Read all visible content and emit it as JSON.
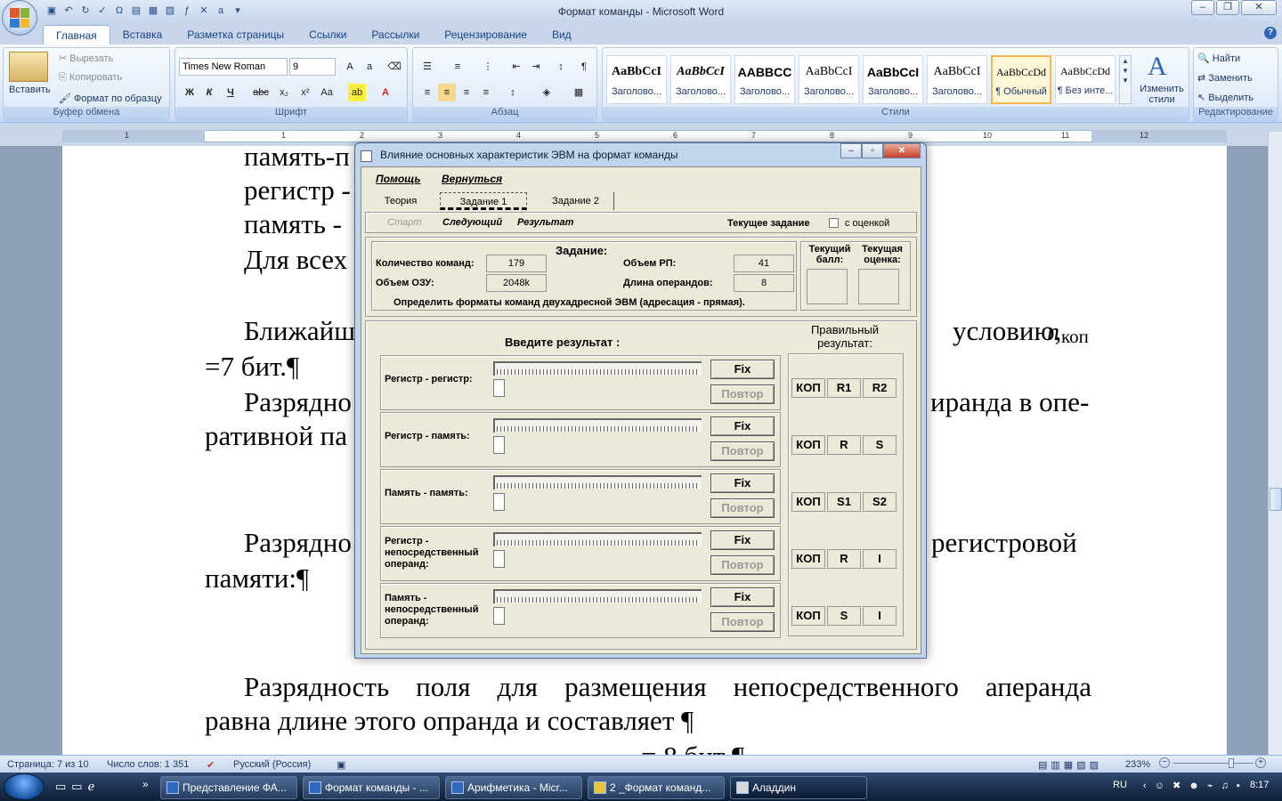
{
  "app": {
    "window_title": "Формат команды - Microsoft Word",
    "tabs": [
      "Главная",
      "Вставка",
      "Разметка страницы",
      "Ссылки",
      "Рассылки",
      "Рецензирование",
      "Вид"
    ],
    "active_tab": "Главная"
  },
  "ribbon": {
    "clipboard": {
      "label": "Буфер обмена",
      "paste": "Вставить",
      "cut": "Вырезать",
      "copy": "Копировать",
      "format_painter": "Формат по образцу"
    },
    "font": {
      "label": "Шрифт",
      "font_name": "Times New Roman",
      "font_size": "9"
    },
    "paragraph": {
      "label": "Абзац"
    },
    "styles": {
      "label": "Стили",
      "items": [
        {
          "sample": "AaBbCcI",
          "name": "Заголово..."
        },
        {
          "sample": "AaBbCcI",
          "name": "Заголово..."
        },
        {
          "sample": "AABBCC",
          "name": "Заголово..."
        },
        {
          "sample": "AaBbCcI",
          "name": "Заголово..."
        },
        {
          "sample": "AaBbCcI",
          "name": "Заголово..."
        },
        {
          "sample": "AaBbCcI",
          "name": "Заголово..."
        },
        {
          "sample": "AaBbCcDd",
          "name": "¶ Обычный"
        },
        {
          "sample": "AaBbCcDd",
          "name": "¶ Без инте..."
        }
      ],
      "change_styles": "Изменить стили"
    },
    "editing": {
      "label": "Редактирование",
      "find": "Найти",
      "replace": "Заменить",
      "select": "Выделить"
    }
  },
  "ruler": {
    "numbers": [
      "1",
      "1",
      "2",
      "3",
      "4",
      "5",
      "6",
      "7",
      "8",
      "9",
      "10",
      "11",
      "12"
    ]
  },
  "document": {
    "lines": [
      "память-п",
      "регистр -",
      "память -",
      "Для всех",
      "Ближайш",
      "условию,",
      "n",
      "коп",
      "=7 бит.¶",
      "Разрядно",
      "иранда в опе-",
      "ративной па",
      "Разрядно",
      "регистровой",
      "памяти:¶",
      "Разрядность поля для размещения непосредственного аперанда",
      "равна длине этого опранда и составляет ¶",
      "= 8 бит ¶"
    ]
  },
  "status": {
    "page": "Страница: 7 из 10",
    "words": "Число слов: 1 351",
    "language": "Русский (Россия)",
    "zoom": "233%"
  },
  "taskbar": {
    "tasks": [
      "Представление ФА...",
      "Формат команды - ...",
      "Арифметика - Micr...",
      "2 _Формат команд...",
      "Аладдин"
    ],
    "lang": "RU",
    "time": "8:17"
  },
  "dialog": {
    "title": "Влияние основных характеристик ЭВМ на формат команды",
    "menu": [
      "Помощь",
      "Вернуться"
    ],
    "tabs": [
      "Теория",
      "Задание 1",
      "Задание 2"
    ],
    "actions": {
      "start": "Старт",
      "next": "Следующий",
      "result": "Результат",
      "current_task": "Текущее задание",
      "with_grade": "с оценкой"
    },
    "task": {
      "heading": "Задание:",
      "cmd_count_label": "Количество команд:",
      "cmd_count": "179",
      "ram_label": "Объем ОЗУ:",
      "ram": "2048k",
      "rp_label": "Объем РП:",
      "rp": "41",
      "operand_label": "Длина операндов:",
      "operand": "8",
      "instruction": "Определить форматы команд двухадресной ЭВМ (адресация - прямая)."
    },
    "score": {
      "current_score": "Текущий балл:",
      "current_grade": "Текущая оценка:"
    },
    "input_heading": "Введите результат :",
    "correct_heading": "Правильный результат:",
    "fix": "Fix",
    "repeat": "Повтор",
    "rows": [
      {
        "label": "Регистр - регистр:",
        "cells": [
          "КОП",
          "R1",
          "R2"
        ]
      },
      {
        "label": "Регистр - память:",
        "cells": [
          "КОП",
          "R",
          "S"
        ]
      },
      {
        "label": "Память - память:",
        "cells": [
          "КОП",
          "S1",
          "S2"
        ]
      },
      {
        "label": "Регистр - непосредственный операнд:",
        "cells": [
          "КОП",
          "R",
          "I"
        ]
      },
      {
        "label": "Память - непосредственный операнд:",
        "cells": [
          "КОП",
          "S",
          "I"
        ]
      }
    ]
  }
}
